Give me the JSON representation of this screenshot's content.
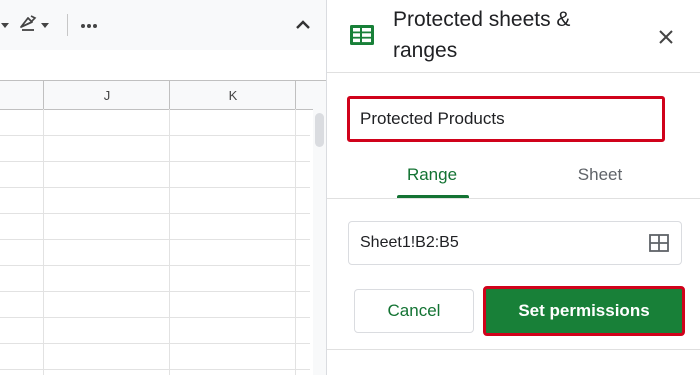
{
  "toolbar": {
    "items": [
      {
        "icon": "text-direction-icon"
      },
      {
        "icon": "text-rotation-icon"
      },
      {
        "icon": "more-icon"
      },
      {
        "icon": "collapse-toolbar-icon"
      }
    ]
  },
  "sheet": {
    "columns": [
      "J",
      "K"
    ]
  },
  "panel": {
    "icon": "sheets-logo-icon",
    "title": "Protected sheets & ranges",
    "description_value": "Protected Products",
    "tabs": [
      {
        "label": "Range",
        "selected": true
      },
      {
        "label": "Sheet",
        "selected": false
      }
    ],
    "range_value": "Sheet1!B2:B5",
    "cancel_label": "Cancel",
    "set_permissions_label": "Set permissions"
  },
  "colors": {
    "accent_green": "#188038",
    "tab_green": "#137333",
    "highlight_red": "#d0021b"
  }
}
